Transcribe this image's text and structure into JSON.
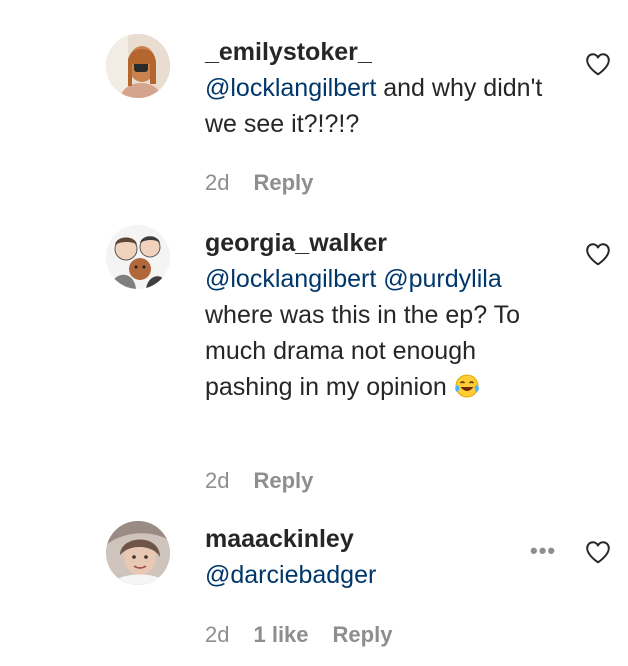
{
  "comments": [
    {
      "username": "_emilystoker_",
      "mentions": [
        "@locklangilbert"
      ],
      "text": "and why didn't we see it?!?!?",
      "time": "2d",
      "likes": "",
      "reply_label": "Reply"
    },
    {
      "username": "georgia_walker",
      "mentions": [
        "@locklangilbert",
        "@purdylila"
      ],
      "text": "where was this in the ep? To much drama not enough pashing in my opinion",
      "emoji": "face-with-tears-of-joy",
      "time": "2d",
      "likes": "",
      "reply_label": "Reply"
    },
    {
      "username": "maaackinley",
      "mentions": [
        "@darciebadger"
      ],
      "text": "",
      "time": "2d",
      "likes": "1 like",
      "reply_label": "Reply",
      "more_label": "•••"
    }
  ],
  "colors": {
    "text": "#262626",
    "mention": "#00376b",
    "secondary": "#8e8e8e"
  }
}
